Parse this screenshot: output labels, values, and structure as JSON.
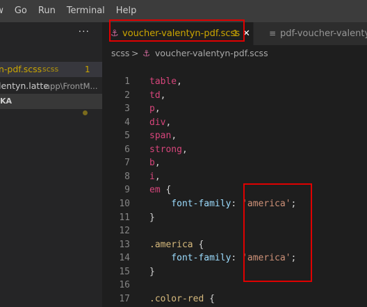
{
  "menubar": {
    "items": [
      "View",
      "Go",
      "Run",
      "Terminal",
      "Help"
    ]
  },
  "sidebar": {
    "more_actions": "···",
    "files": [
      {
        "name": "n-pdf.scss",
        "ext": "scss",
        "badge": "1"
      },
      {
        "name": "lentyn.latte",
        "path": "app\\FrontM..."
      }
    ],
    "section_label": "KA"
  },
  "tabs": {
    "active": {
      "label": "voucher-valentyn-pdf.scss",
      "badge": "1",
      "close": "✕"
    },
    "inactive": {
      "label": "pdf-voucher-valentyn"
    }
  },
  "breadcrumb": {
    "segment1": "scss",
    "separator": ">",
    "segment2": "voucher-valentyn-pdf.scss"
  },
  "code": {
    "line_numbers": [
      "1",
      "2",
      "3",
      "4",
      "5",
      "6",
      "7",
      "8",
      "9",
      "10",
      "11",
      "12",
      "13",
      "14",
      "15",
      "16",
      "17"
    ],
    "lines": [
      [
        {
          "t": "table",
          "c": "tag"
        },
        {
          "t": ",",
          "c": "punc"
        }
      ],
      [
        {
          "t": "td",
          "c": "tag"
        },
        {
          "t": ",",
          "c": "punc"
        }
      ],
      [
        {
          "t": "p",
          "c": "tag"
        },
        {
          "t": ",",
          "c": "punc"
        }
      ],
      [
        {
          "t": "div",
          "c": "tag"
        },
        {
          "t": ",",
          "c": "punc"
        }
      ],
      [
        {
          "t": "span",
          "c": "tag"
        },
        {
          "t": ",",
          "c": "punc"
        }
      ],
      [
        {
          "t": "strong",
          "c": "tag"
        },
        {
          "t": ",",
          "c": "punc"
        }
      ],
      [
        {
          "t": "b",
          "c": "tag"
        },
        {
          "t": ",",
          "c": "punc"
        }
      ],
      [
        {
          "t": "i",
          "c": "tag"
        },
        {
          "t": ",",
          "c": "punc"
        }
      ],
      [
        {
          "t": "em",
          "c": "tag"
        },
        {
          "t": " {",
          "c": "punc"
        }
      ],
      [
        {
          "t": "    font-family",
          "c": "prop"
        },
        {
          "t": ": ",
          "c": "punc"
        },
        {
          "t": "'america'",
          "c": "str"
        },
        {
          "t": ";",
          "c": "punc"
        }
      ],
      [
        {
          "t": "}",
          "c": "punc"
        }
      ],
      [],
      [
        {
          "t": ".america",
          "c": "cls"
        },
        {
          "t": " {",
          "c": "punc"
        }
      ],
      [
        {
          "t": "    font-family",
          "c": "prop"
        },
        {
          "t": ": ",
          "c": "punc"
        },
        {
          "t": "'america'",
          "c": "str"
        },
        {
          "t": ";",
          "c": "punc"
        }
      ],
      [
        {
          "t": "}",
          "c": "punc"
        }
      ],
      [],
      [
        {
          "t": ".color-red",
          "c": "cls"
        },
        {
          "t": " {",
          "c": "punc"
        }
      ]
    ]
  },
  "colors": {
    "menubar_bg": "#3c3c3c",
    "sidebar_bg": "#252526",
    "editor_bg": "#1e1e1e",
    "warning": "#cca700",
    "annotation_red": "#e00000"
  }
}
